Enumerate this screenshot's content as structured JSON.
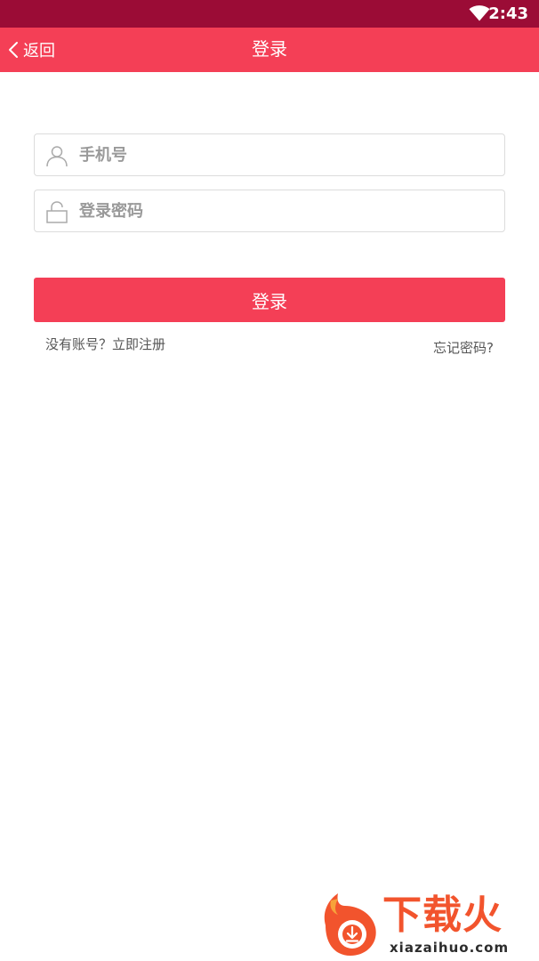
{
  "status_bar": {
    "time": "2:43",
    "wifi_icon": "wifi-icon"
  },
  "nav": {
    "back_label": "返回",
    "back_icon": "chevron-left-icon",
    "title": "登录"
  },
  "form": {
    "phone_placeholder": "手机号",
    "phone_icon": "user-icon",
    "password_placeholder": "登录密码",
    "password_icon": "lock-icon",
    "login_label": "登录",
    "register_label": "没有账号？立即注册",
    "forgot_label": "忘记密码?"
  },
  "watermark": {
    "brand_name": "下载火",
    "brand_domain": "xiazaihuo.com"
  },
  "colors": {
    "status_bar": "#9b0c36",
    "accent": "#f43f56",
    "brand": "#f2542d"
  }
}
